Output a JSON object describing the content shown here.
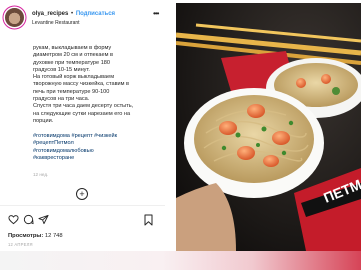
{
  "post": {
    "username": "olya_recipes",
    "separator": "•",
    "follow_label": "Подписаться",
    "location": "Levantine Restaurant",
    "caption": [
      "рукам, выкладываем в форму",
      "диаметром 20 см и отпекаем в",
      "духовке при температуре 180",
      "градусов 10-15 минут.",
      "На готовый корж выкладываем",
      "творожную массу чизкейка, ставим в",
      "печь при температуре 90-100",
      "градусов на три часа.",
      "Спустя три часа даем десерту остыть,",
      "на следующие сутки нарезаем его на",
      "порции."
    ],
    "hashtags": [
      "#готовимдома #рецепт #чизкейк",
      "#рецептПетмол",
      "#готовимдомалюбовью",
      "#каквресторане"
    ],
    "time_ago": "12 нед.",
    "views_label": "Просмотры:",
    "views_count": "12 748",
    "date": "12 АПРЕЛЯ"
  },
  "icons": {
    "more": "more-icon",
    "add_comment": "add-comment-icon",
    "like": "heart-icon",
    "comment": "comment-icon",
    "share": "share-icon",
    "save": "bookmark-icon"
  },
  "photo": {
    "package_text": "ПЕТМО"
  }
}
